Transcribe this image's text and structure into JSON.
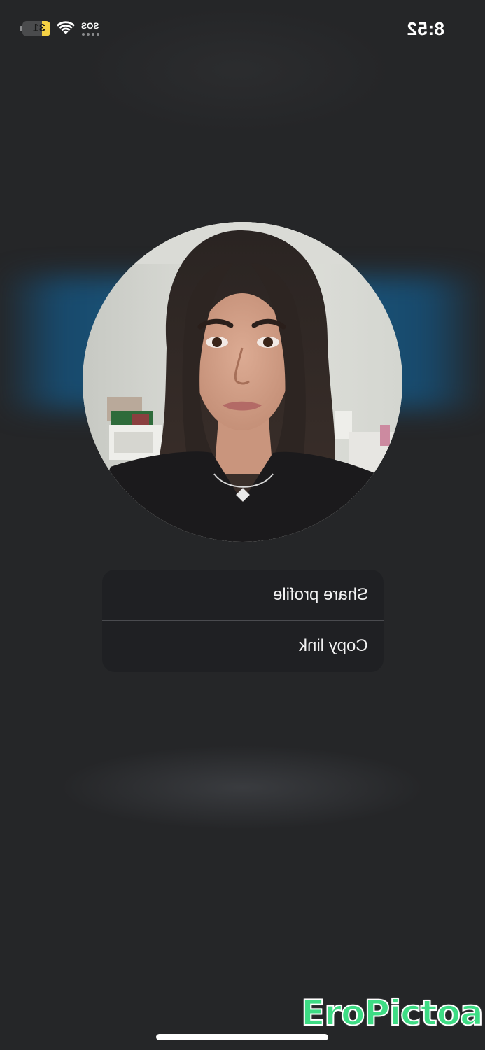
{
  "status_bar": {
    "time": "8:52",
    "carrier": "SOS",
    "battery_level": "31",
    "battery_fraction": 0.31,
    "wifi_icon": "wifi-icon",
    "battery_icon": "battery-icon"
  },
  "profile": {
    "avatar": "profile-photo"
  },
  "menu": {
    "share_profile": "Share profile",
    "copy_link": "Copy link"
  },
  "watermark": {
    "text": "EroPictoa"
  },
  "colors": {
    "background": "#252628",
    "glow": "#1a5f8c",
    "menu_background": "#1f2023",
    "battery": "#f5d245",
    "watermark": "#3ddc84"
  }
}
